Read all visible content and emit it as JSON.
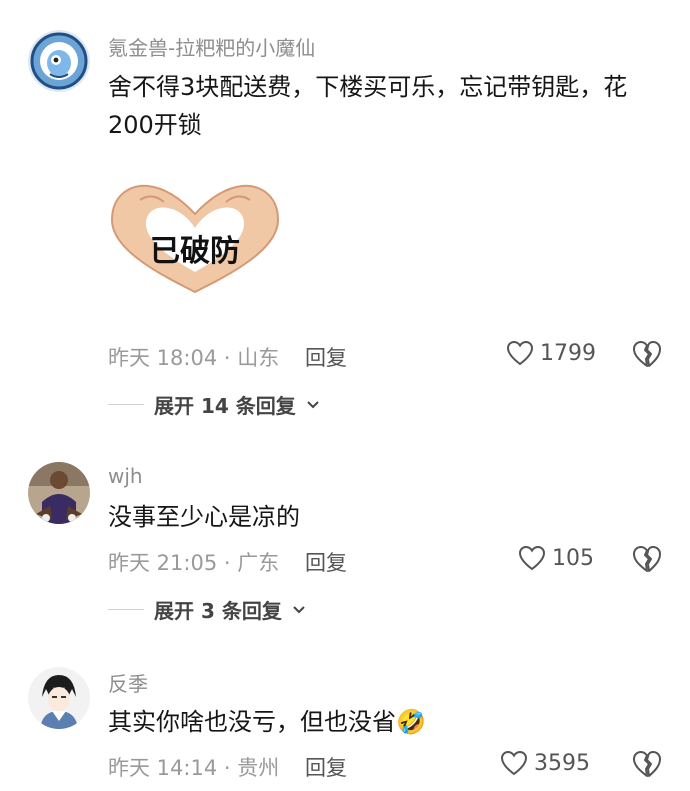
{
  "comments": [
    {
      "username": "氪金兽-拉粑粑的小魔仙",
      "text": "舍不得3块配送费，下楼买可乐，忘记带钥匙，花200开锁",
      "sticker_text": "已破防",
      "time": "昨天 18:04 · 山东",
      "reply_label": "回复",
      "likes": "1799",
      "expand_label": "展开 14 条回复"
    },
    {
      "username": "wjh",
      "text": "没事至少心是凉的",
      "time": "昨天 21:05 · 广东",
      "reply_label": "回复",
      "likes": "105",
      "expand_label": "展开 3 条回复"
    },
    {
      "username": "反季",
      "text": "其实你啥也没亏，但也没省",
      "emoji": "🤣",
      "time": "昨天 14:14 · 贵州",
      "reply_label": "回复",
      "likes": "3595"
    }
  ],
  "icons": {
    "like": "heart-outline-icon",
    "dislike": "broken-heart-icon",
    "expand": "chevron-down-icon"
  }
}
